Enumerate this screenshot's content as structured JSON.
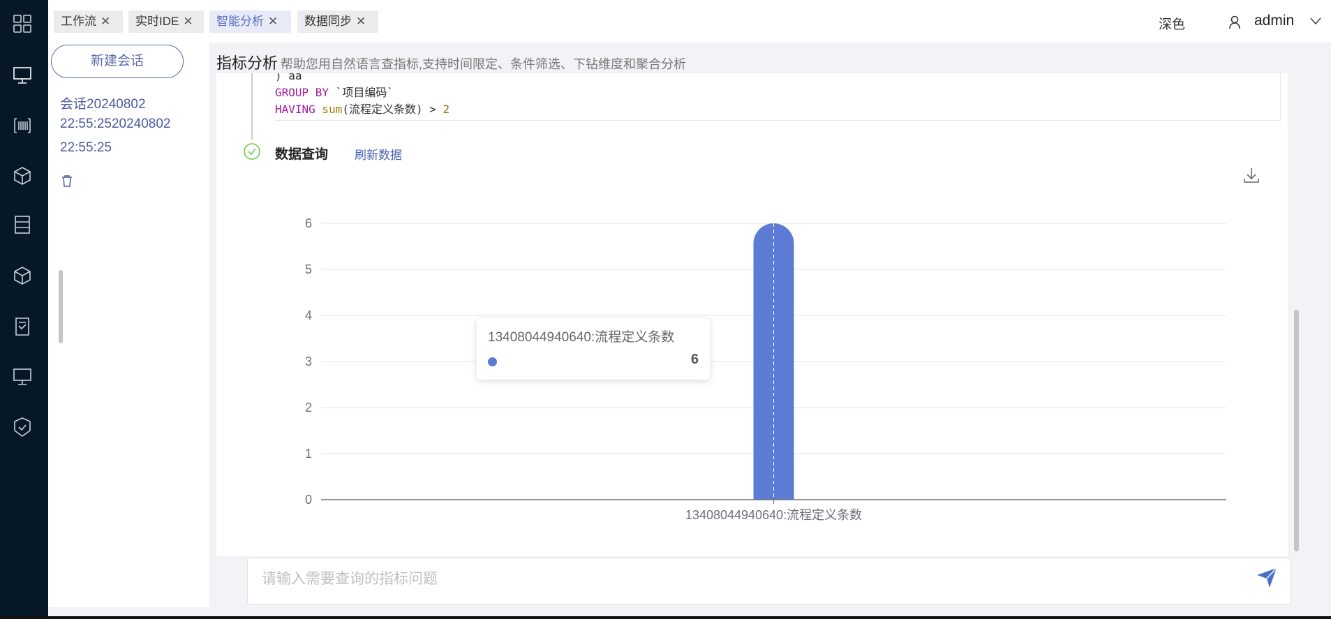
{
  "tabs": [
    {
      "label": "工作流"
    },
    {
      "label": "实时IDE"
    },
    {
      "label": "智能分析",
      "active": true
    },
    {
      "label": "数据同步"
    }
  ],
  "header": {
    "theme": "深色",
    "user": "admin"
  },
  "sidebar_icons": [
    "apps-grid-icon",
    "monitor-icon",
    "barcode-icon",
    "cube-icon",
    "server-icon",
    "box-icon",
    "document-check-icon",
    "desktop-icon",
    "shield-check-icon"
  ],
  "session": {
    "new_label": "新建会话",
    "lines": [
      "会话20240802",
      "22:55:2520240802",
      "22:55:25"
    ]
  },
  "page": {
    "title": "指标分析",
    "subtitle": "帮助您用自然语言查指标,支持时间限定、条件筛选、下钻维度和聚合分析"
  },
  "code": {
    "line0": ") aa",
    "l1_kw": "GROUP BY",
    "l1_rest": " `项目编码`",
    "l2_kw": "HAVING",
    "l2_fn": " sum",
    "l2_mid": "(流程定义条数) > ",
    "l2_num": "2"
  },
  "query": {
    "title": "数据查询",
    "refresh": "刷新数据"
  },
  "input": {
    "placeholder": "请输入需要查询的指标问题"
  },
  "colors": {
    "bar": "#5b7bd5",
    "accent": "#4a63b5"
  },
  "chart_data": {
    "type": "bar",
    "categories": [
      "13408044940640:流程定义条数"
    ],
    "values": [
      6
    ],
    "yticks": [
      "0",
      "1",
      "2",
      "3",
      "4",
      "5",
      "6"
    ],
    "ylim": [
      0,
      6
    ],
    "grid": true,
    "tooltip": {
      "title": "13408044940640:流程定义条数",
      "value": "6"
    }
  }
}
